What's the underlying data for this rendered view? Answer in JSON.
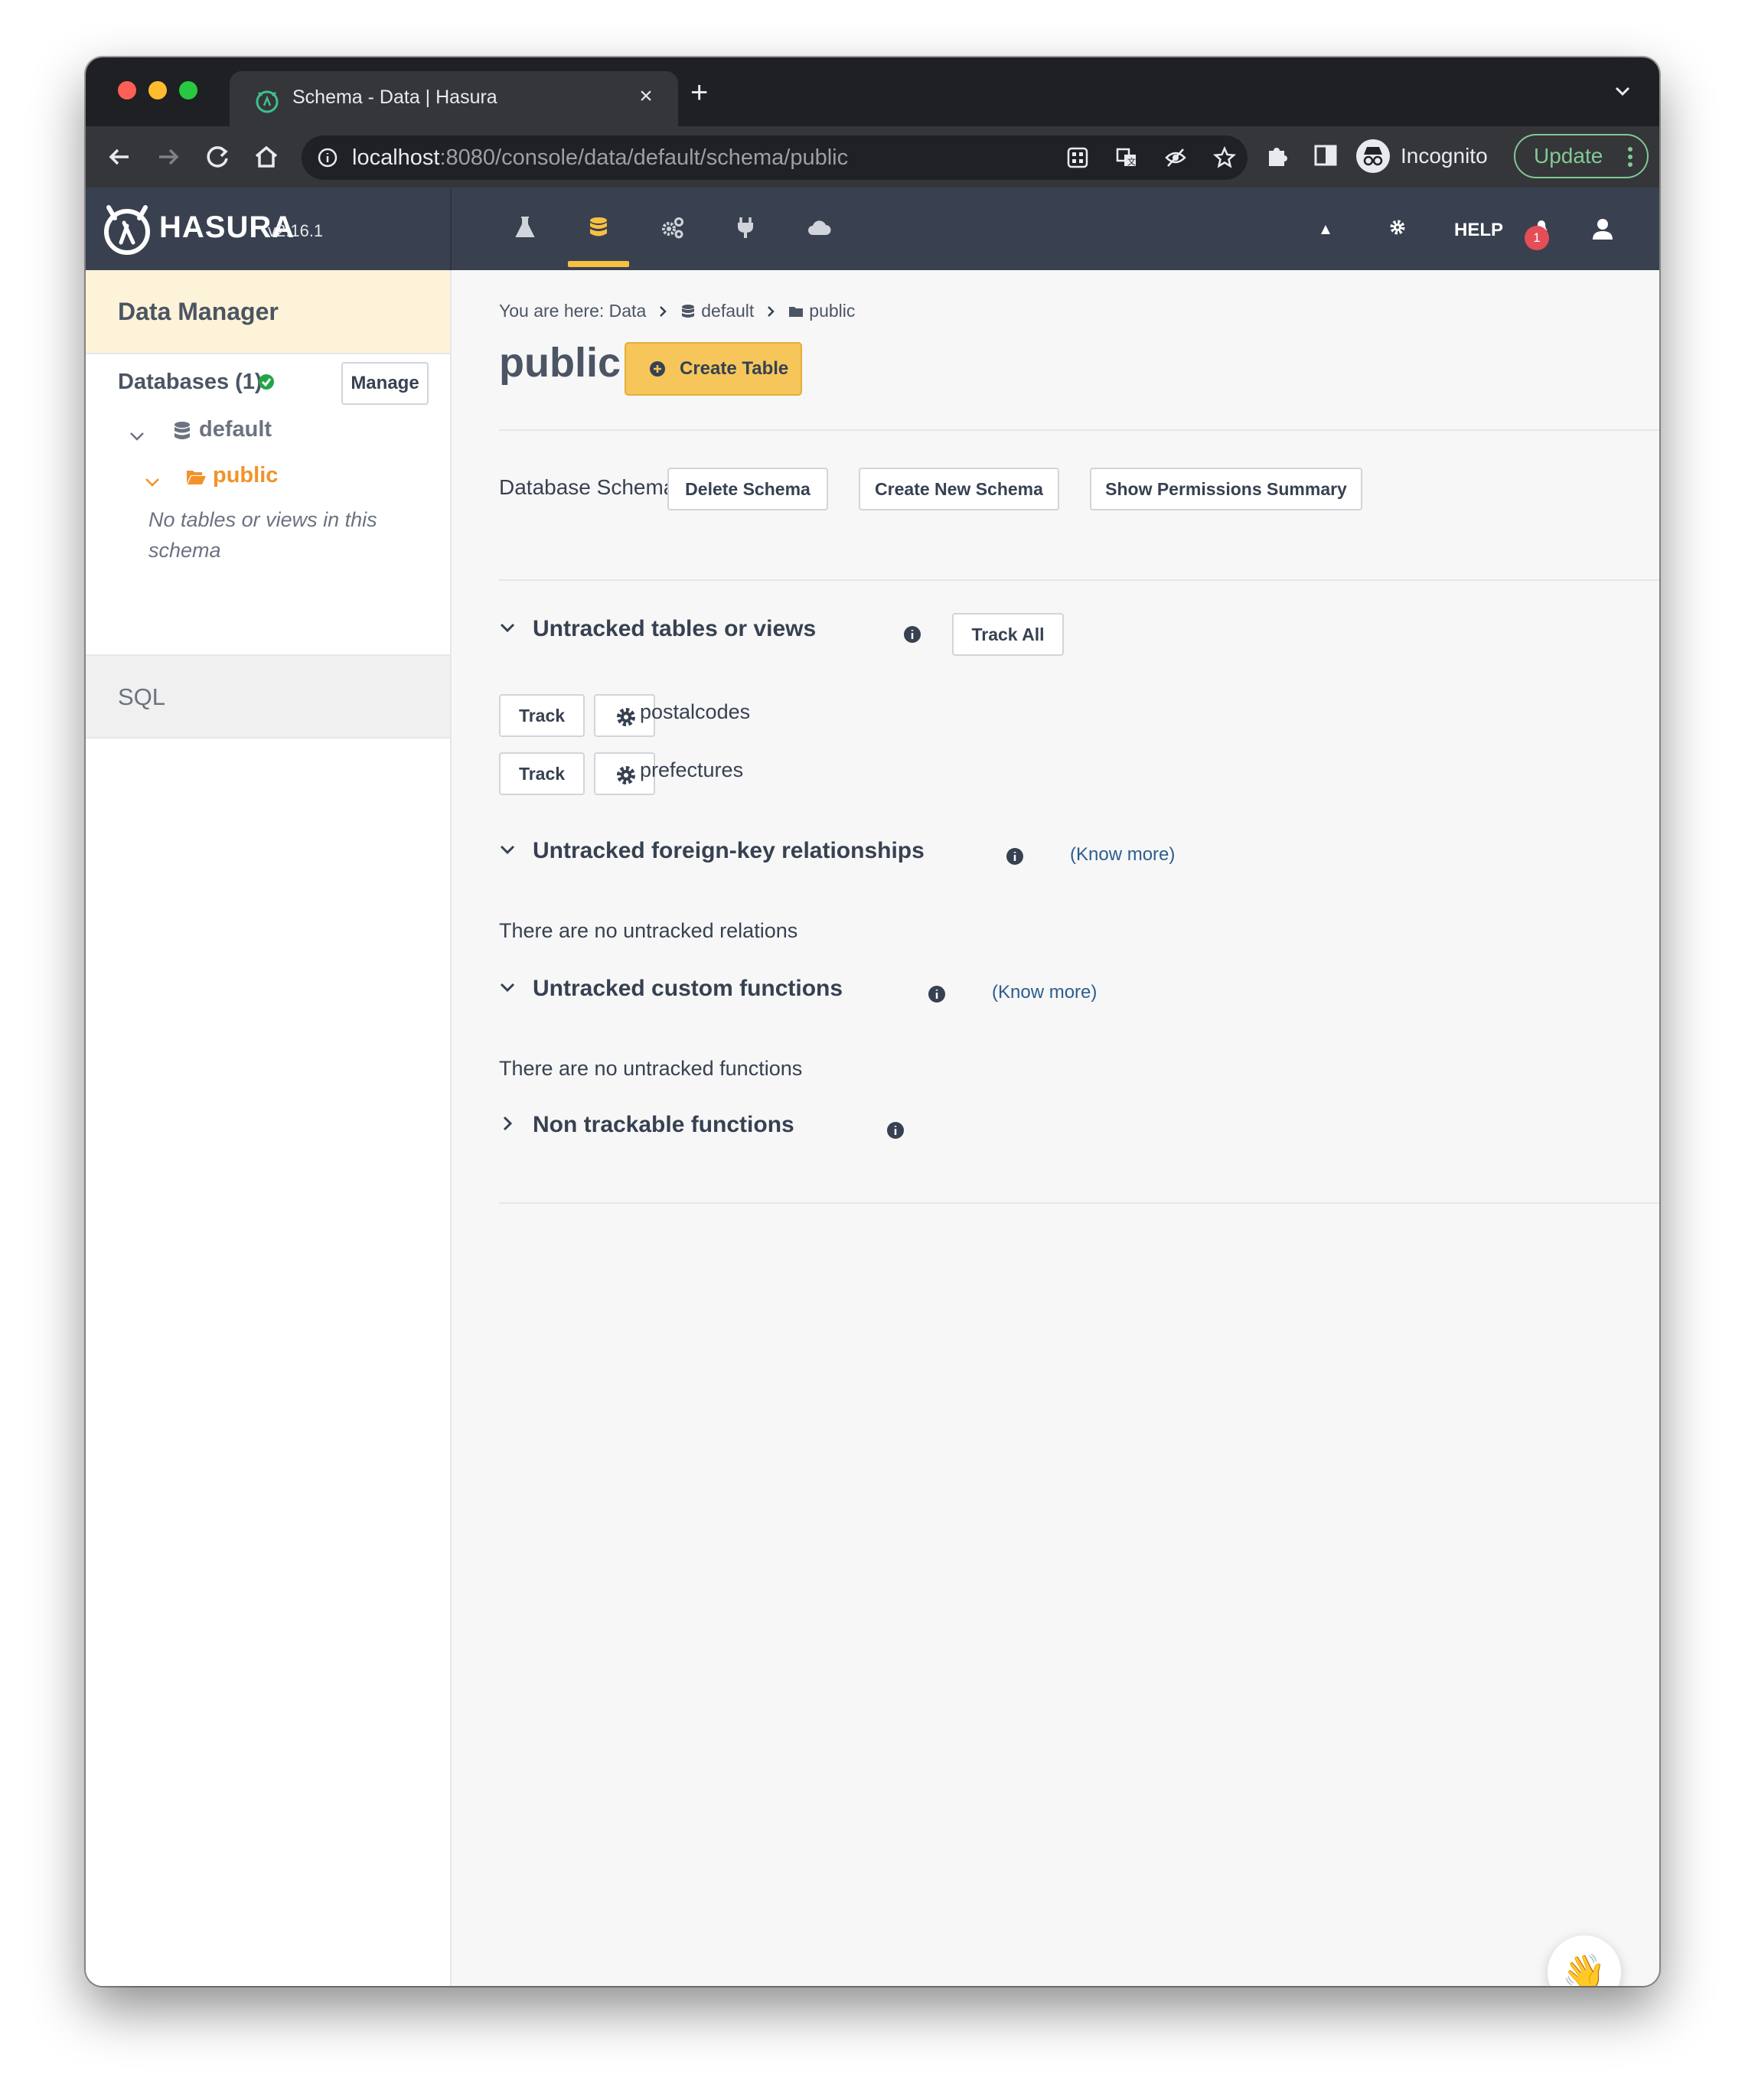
{
  "browser": {
    "tab_title": "Schema - Data | Hasura",
    "tab_close": "×",
    "new_tab": "+",
    "url_host": "localhost",
    "url_path": ":8080/console/data/default/schema/public",
    "incognito_label": "Incognito",
    "update_label": "Update"
  },
  "header": {
    "brand": "HASURA",
    "version": "v2.16.1",
    "nav": [
      "api-explorer",
      "data",
      "actions",
      "remote-schemas",
      "cloud"
    ],
    "active_nav": "data",
    "help": "HELP",
    "notification_count": "1"
  },
  "sidebar": {
    "title": "Data Manager",
    "databases_label": "Databases (1)",
    "manage_label": "Manage",
    "database_name": "default",
    "schema_name": "public",
    "empty_note": "No tables or views in this schema",
    "sql_label": "SQL"
  },
  "main": {
    "breadcrumb": {
      "prefix": "You are here: Data",
      "database": "default",
      "schema": "public"
    },
    "title": "public",
    "create_table_label": "Create Table",
    "schema_label": "Database Schema",
    "delete_schema": "Delete Schema",
    "create_schema": "Create New Schema",
    "permissions_summary": "Show Permissions Summary",
    "untracked_tables": {
      "title": "Untracked tables or views",
      "track_all": "Track All",
      "rows": [
        {
          "action": "Track",
          "name": "postalcodes"
        },
        {
          "action": "Track",
          "name": "prefectures"
        }
      ]
    },
    "fk_relationships": {
      "title": "Untracked foreign-key relationships",
      "know_more": "(Know more)",
      "empty": "There are no untracked relations"
    },
    "custom_functions": {
      "title": "Untracked custom functions",
      "know_more": "(Know more)",
      "empty": "There are no untracked functions"
    },
    "non_trackable": {
      "title": "Non trackable functions"
    },
    "wave_emoji": "👋"
  },
  "colors": {
    "header_bg": "#394150",
    "accent": "#f6c141",
    "sidebar_highlight": "#fdf3d8",
    "schema_orange": "#f0932b",
    "link": "#2c5e8e"
  }
}
